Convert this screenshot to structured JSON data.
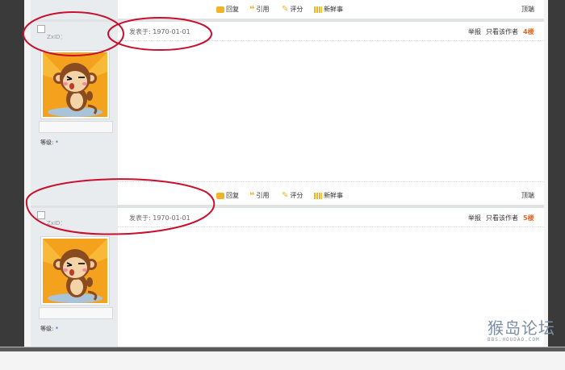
{
  "actions": {
    "reply": "回复",
    "quote": "引用",
    "rate": "评分",
    "news": "新鲜事",
    "top": "顶端"
  },
  "posts": [
    {
      "username": "ZxID：",
      "date": "发表于: 1970-01-01",
      "report": "举报",
      "only_author": "只看该作者",
      "floor": "4楼",
      "level_label": "等级:",
      "level_value": "*"
    },
    {
      "username": "ZxID：",
      "date": "发表于: 1970-01-01",
      "report": "举报",
      "only_author": "只看该作者",
      "floor": "5楼",
      "level_label": "等级:",
      "level_value": "*"
    }
  ],
  "watermark": {
    "title": "猴岛论坛",
    "url": "BBS.HOUDAO.COM"
  },
  "colors": {
    "annotation": "#c8102e",
    "floor": "#e8631a",
    "sidebar": "#e9ecef"
  }
}
